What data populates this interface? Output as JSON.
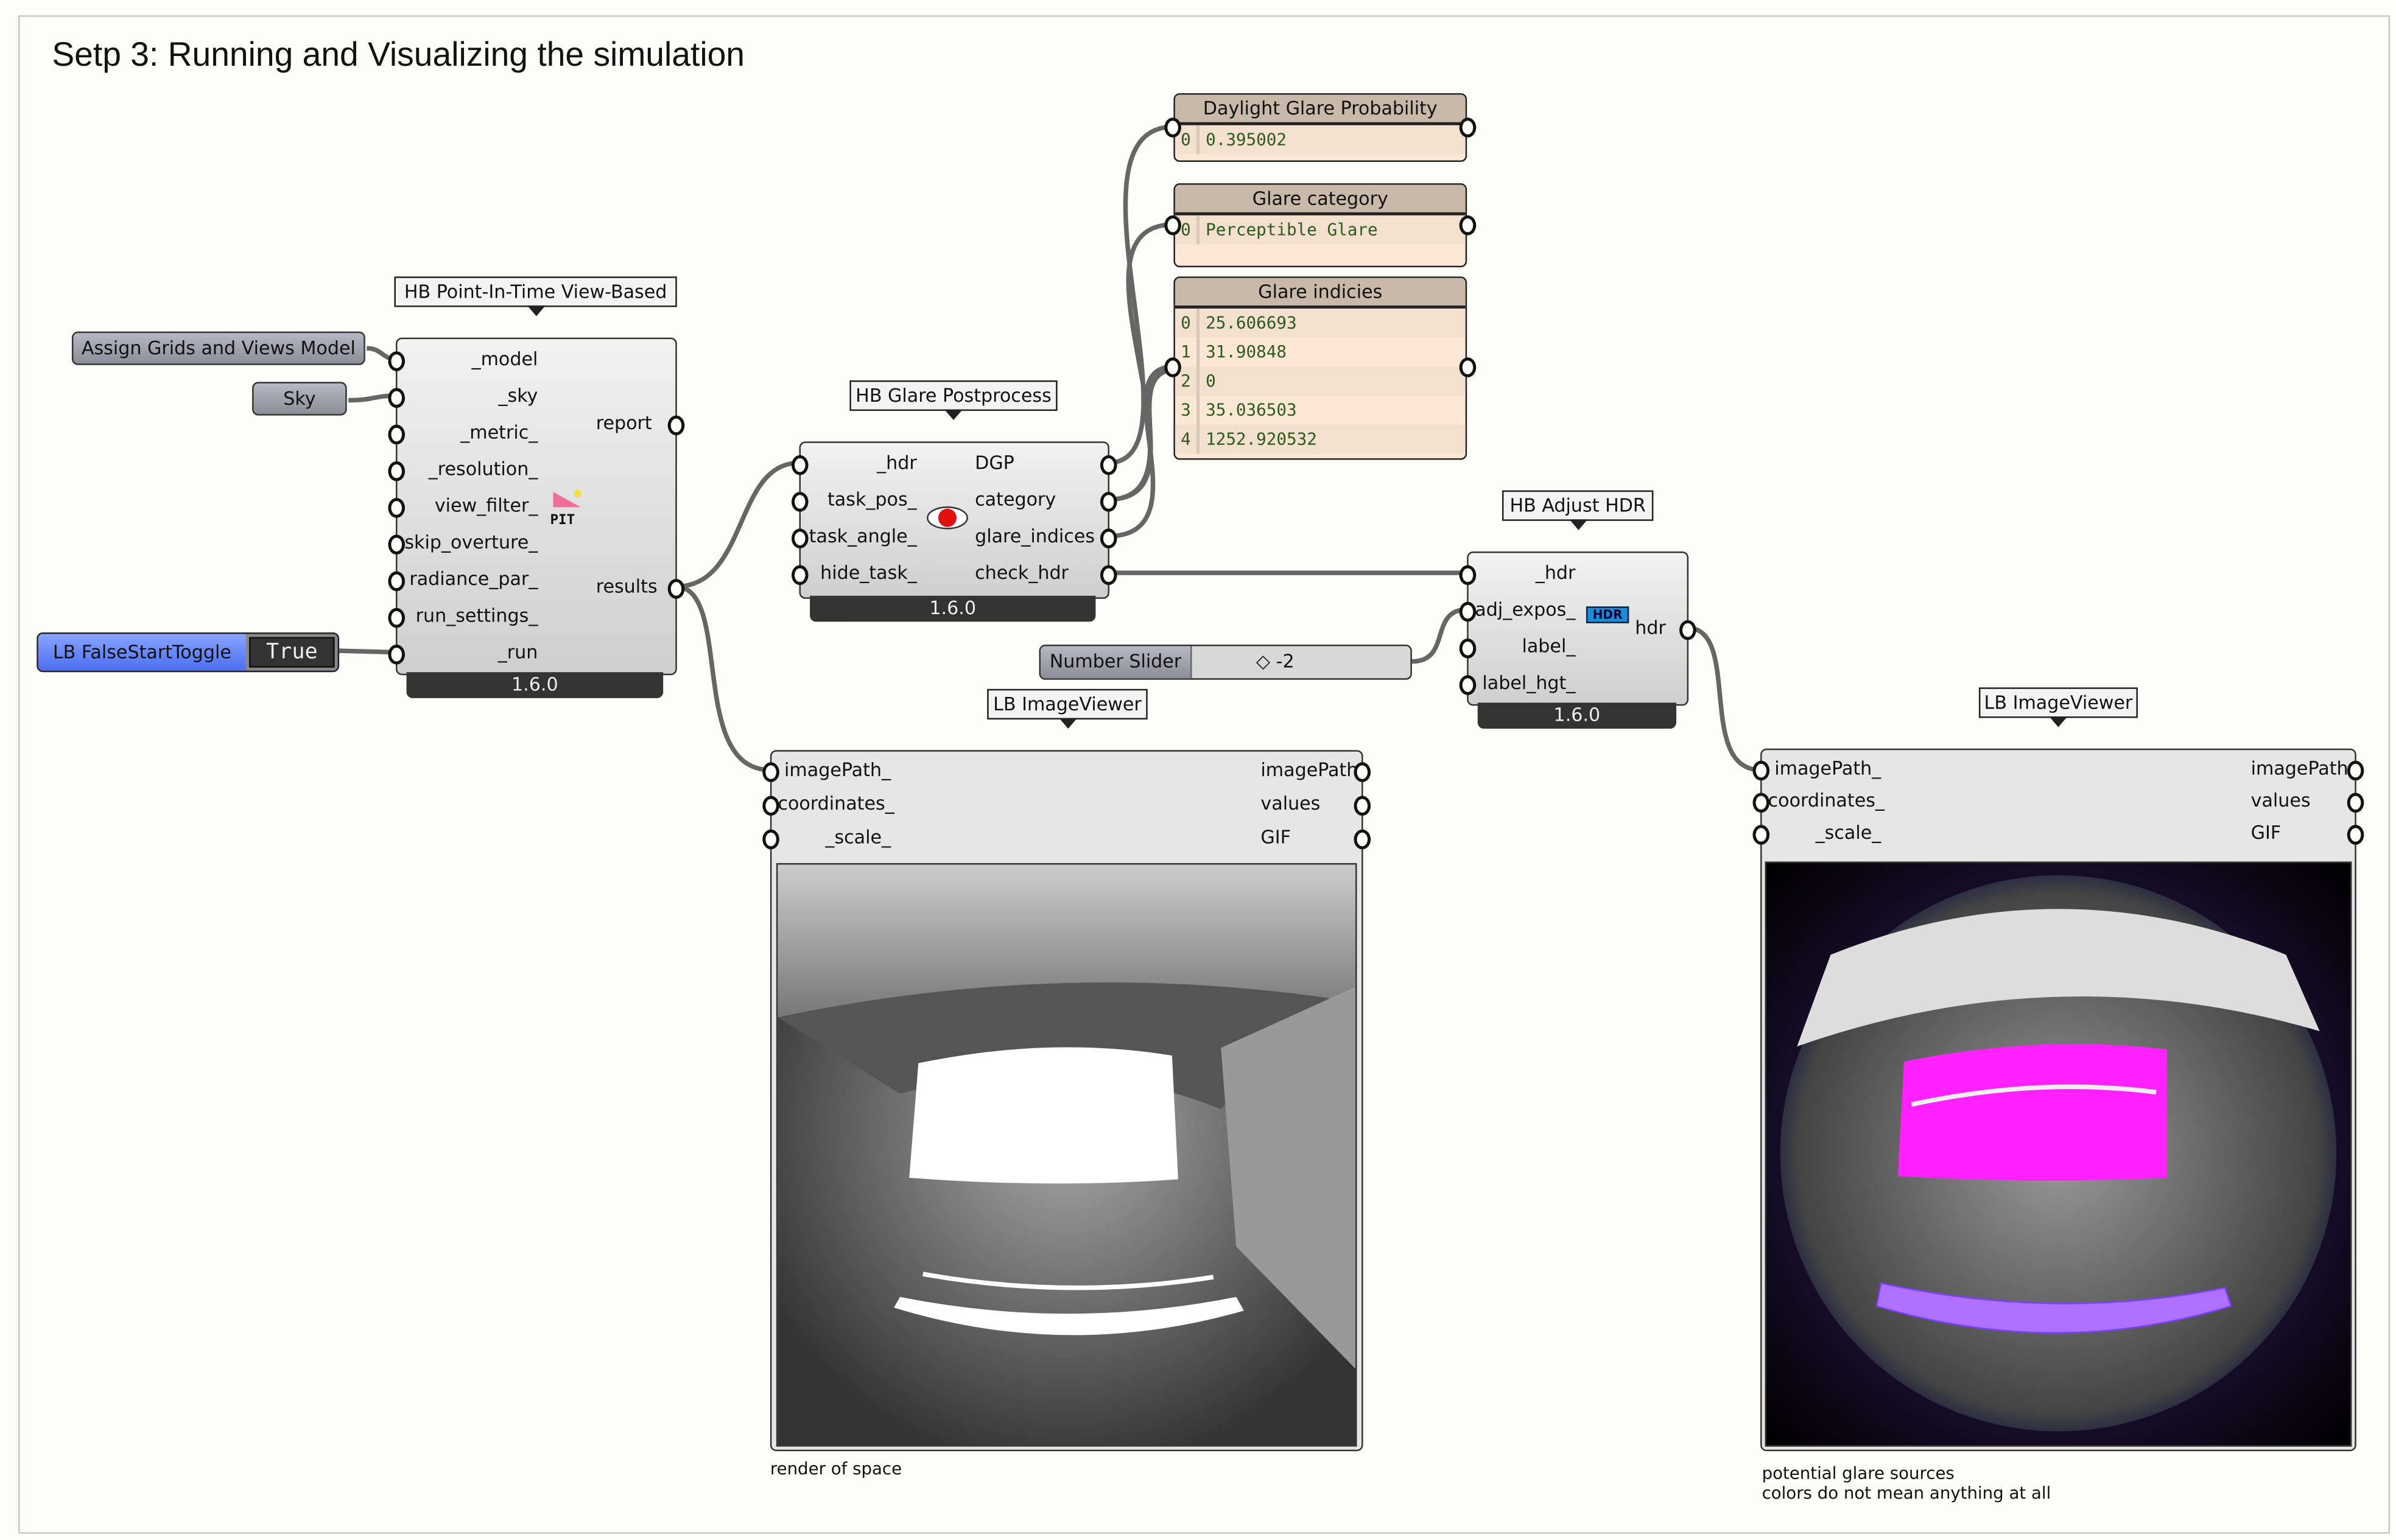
{
  "title": "Setp 3: Running and Visualizing the simulation",
  "version": "1.6.0",
  "params": {
    "model": "Assign Grids and Views Model",
    "sky": "Sky"
  },
  "toggle": {
    "label": "LB FalseStartToggle",
    "value": "True",
    "color": "#5a7ef0"
  },
  "pit": {
    "name": "HB Point-In-Time View-Based",
    "icon": "PIT",
    "inputs": [
      "_model",
      "_sky",
      "_metric_",
      "_resolution_",
      "view_filter_",
      "skip_overture_",
      "radiance_par_",
      "run_settings_",
      "_run"
    ],
    "outputs": [
      "report",
      "results"
    ]
  },
  "glare": {
    "name": "HB Glare Postprocess",
    "inputs": [
      "_hdr",
      "task_pos_",
      "task_angle_",
      "hide_task_"
    ],
    "outputs": [
      "DGP",
      "category",
      "glare_indices",
      "check_hdr"
    ]
  },
  "panels": {
    "dgp": {
      "title": "Daylight Glare Probability",
      "rows": [
        {
          "i": "0",
          "v": "0.395002"
        }
      ]
    },
    "category": {
      "title": "Glare category",
      "rows": [
        {
          "i": "0",
          "v": "Perceptible Glare"
        }
      ]
    },
    "indices": {
      "title": "Glare indicies",
      "rows": [
        {
          "i": "0",
          "v": "25.606693"
        },
        {
          "i": "1",
          "v": "31.90848"
        },
        {
          "i": "2",
          "v": "0"
        },
        {
          "i": "3",
          "v": "35.036503"
        },
        {
          "i": "4",
          "v": "1252.920532"
        }
      ]
    }
  },
  "adjust": {
    "name": "HB Adjust HDR",
    "icon": "HDR",
    "inputs": [
      "_hdr",
      "adj_expos_",
      "label_",
      "label_hgt_"
    ],
    "outputs": [
      "hdr"
    ]
  },
  "slider": {
    "label": "Number Slider",
    "value": "-2"
  },
  "viewer1": {
    "name": "LB ImageViewer",
    "inputs": [
      "imagePath_",
      "coordinates_",
      "_scale_"
    ],
    "outputs": [
      "imagePath",
      "values",
      "GIF"
    ],
    "caption": "render of space"
  },
  "viewer2": {
    "name": "LB ImageViewer",
    "inputs": [
      "imagePath_",
      "coordinates_",
      "_scale_"
    ],
    "outputs": [
      "imagePath",
      "values",
      "GIF"
    ],
    "caption1": "potential glare sources",
    "caption2": "colors do not mean anything at all",
    "glare_color": "#ff22ff"
  }
}
